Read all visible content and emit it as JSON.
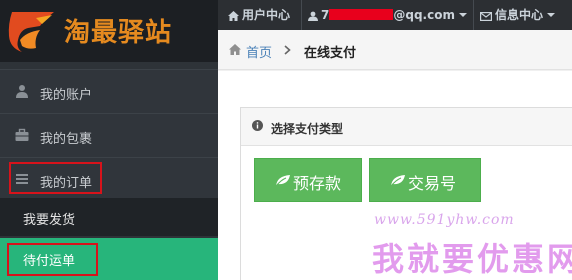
{
  "brand": {
    "name": "淘最驿站",
    "logo_icon": "phoenix-logo-icon"
  },
  "sidebar": {
    "items": [
      {
        "label": "我的账户",
        "icon": "user-icon"
      },
      {
        "label": "我的包裹",
        "icon": "briefcase-icon"
      },
      {
        "label": "我的订单",
        "icon": "list-icon"
      }
    ],
    "subitems": [
      {
        "label": "我要发货"
      },
      {
        "label": "待付运单",
        "active": true
      }
    ]
  },
  "topbar": {
    "user_center": "用户中心",
    "email_prefix": "7",
    "email_suffix": "@qq.com",
    "messages": "信息中心"
  },
  "breadcrumb": {
    "home": "首页",
    "current": "在线支付"
  },
  "panel": {
    "title": "选择支付类型",
    "buttons": [
      {
        "label": "预存款",
        "icon": "leaf-icon"
      },
      {
        "label": "交易号",
        "icon": "leaf-icon"
      }
    ]
  },
  "watermark": {
    "url": "www.591yhw.com",
    "text": "我就要优惠网"
  },
  "colors": {
    "sidebar_bg": "#2e3338",
    "active_green": "#27b57b",
    "button_green": "#5cb85c",
    "highlight_red": "#d7131b",
    "logo_orange": "#e58a1f",
    "link_blue": "#4b82b8"
  }
}
